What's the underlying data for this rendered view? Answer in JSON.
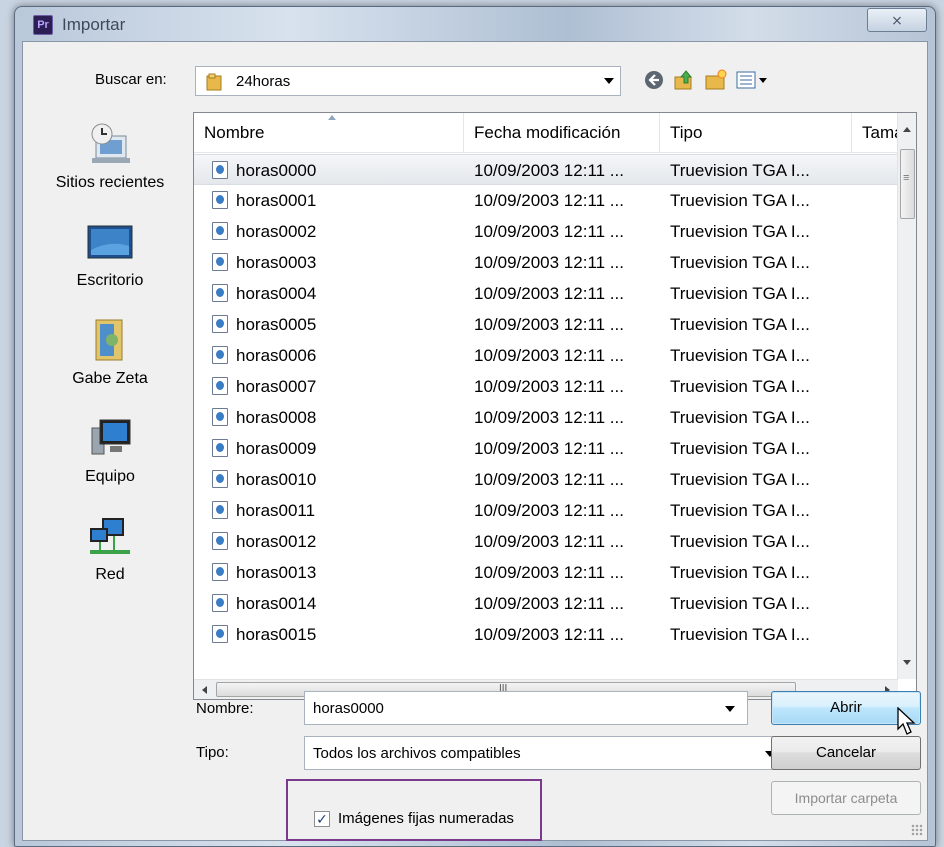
{
  "window": {
    "title": "Importar",
    "app_badge": "Pr",
    "close_glyph": "⨯"
  },
  "toolbar": {
    "lookin_label": "Buscar en:",
    "lookin_value": "24horas",
    "icons": [
      "back-icon",
      "up-folder-icon",
      "new-folder-icon",
      "view-menu-icon"
    ]
  },
  "places": [
    {
      "label": "Sitios recientes",
      "icon": "recent-places-icon"
    },
    {
      "label": "Escritorio",
      "icon": "desktop-icon"
    },
    {
      "label": "Gabe Zeta",
      "icon": "user-folder-icon"
    },
    {
      "label": "Equipo",
      "icon": "computer-icon"
    },
    {
      "label": "Red",
      "icon": "network-icon"
    }
  ],
  "list": {
    "columns": [
      "Nombre",
      "Fecha modificación",
      "Tipo",
      "Tamaño"
    ],
    "rows": [
      {
        "name": "horas0000",
        "date": "10/09/2003 12:11 ...",
        "type": "Truevision TGA I..."
      },
      {
        "name": "horas0001",
        "date": "10/09/2003 12:11 ...",
        "type": "Truevision TGA I..."
      },
      {
        "name": "horas0002",
        "date": "10/09/2003 12:11 ...",
        "type": "Truevision TGA I..."
      },
      {
        "name": "horas0003",
        "date": "10/09/2003 12:11 ...",
        "type": "Truevision TGA I..."
      },
      {
        "name": "horas0004",
        "date": "10/09/2003 12:11 ...",
        "type": "Truevision TGA I..."
      },
      {
        "name": "horas0005",
        "date": "10/09/2003 12:11 ...",
        "type": "Truevision TGA I..."
      },
      {
        "name": "horas0006",
        "date": "10/09/2003 12:11 ...",
        "type": "Truevision TGA I..."
      },
      {
        "name": "horas0007",
        "date": "10/09/2003 12:11 ...",
        "type": "Truevision TGA I..."
      },
      {
        "name": "horas0008",
        "date": "10/09/2003 12:11 ...",
        "type": "Truevision TGA I..."
      },
      {
        "name": "horas0009",
        "date": "10/09/2003 12:11 ...",
        "type": "Truevision TGA I..."
      },
      {
        "name": "horas0010",
        "date": "10/09/2003 12:11 ...",
        "type": "Truevision TGA I..."
      },
      {
        "name": "horas0011",
        "date": "10/09/2003 12:11 ...",
        "type": "Truevision TGA I..."
      },
      {
        "name": "horas0012",
        "date": "10/09/2003 12:11 ...",
        "type": "Truevision TGA I..."
      },
      {
        "name": "horas0013",
        "date": "10/09/2003 12:11 ...",
        "type": "Truevision TGA I..."
      },
      {
        "name": "horas0014",
        "date": "10/09/2003 12:11 ...",
        "type": "Truevision TGA I..."
      },
      {
        "name": "horas0015",
        "date": "10/09/2003 12:11 ...",
        "type": "Truevision TGA I..."
      }
    ],
    "selected_index": 0,
    "hscroll_glyph": "III",
    "vscroll_glyph": "≡"
  },
  "form": {
    "name_label": "Nombre:",
    "name_value": "horas0000",
    "type_label": "Tipo:",
    "type_value": "Todos los archivos compatibles",
    "open_button": "Abrir",
    "cancel_button": "Cancelar",
    "import_folder_button": "Importar carpeta",
    "sequence_label": "Imágenes fijas numeradas",
    "sequence_checked": true,
    "check_glyph": "✓"
  },
  "colors": {
    "highlight_box": "#7a3a8c",
    "default_button": "#3c7fb1"
  }
}
